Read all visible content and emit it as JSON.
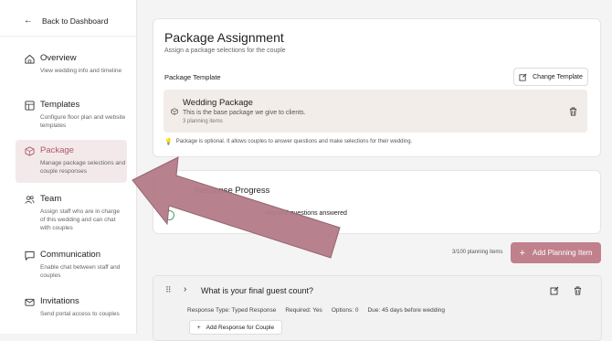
{
  "sidebar": {
    "back_label": "Back to Dashboard",
    "items": [
      {
        "title": "Overview",
        "desc": "View wedding info and timeline"
      },
      {
        "title": "Templates",
        "desc": "Configure floor plan and website templates"
      },
      {
        "title": "Package",
        "desc": "Manage package selections and couple responses"
      },
      {
        "title": "Team",
        "desc": "Assign staff who are in charge of this wedding and can chat with couples"
      },
      {
        "title": "Communication",
        "desc": "Enable chat between staff and couples"
      },
      {
        "title": "Invitations",
        "desc": "Send portal access to couples"
      }
    ]
  },
  "main": {
    "title": "Package Assignment",
    "subtitle": "Assign a package selections for the couple",
    "template_label": "Package Template",
    "change_template": "Change Template",
    "package": {
      "name": "Wedding Package",
      "desc": "This is the base package we give to clients.",
      "count": "3 planning items"
    },
    "note": "Package is optional. It allows couples to answer questions and make selections for their wedding.",
    "response_title": "Response Progress",
    "response_text": "required questions answered",
    "planning_count": "3/100 planning items",
    "add_planning_item": "Add Planning Item",
    "question": {
      "title": "What is your final guest count?",
      "response_type": "Response Type: Typed Response",
      "required": "Required: Yes",
      "options": "Options: 0",
      "due": "Due: 45 days before wedding",
      "add_response": "Add Response for Couple"
    }
  },
  "colors": {
    "accent": "#c0818c",
    "arrow": "#b47c88"
  }
}
